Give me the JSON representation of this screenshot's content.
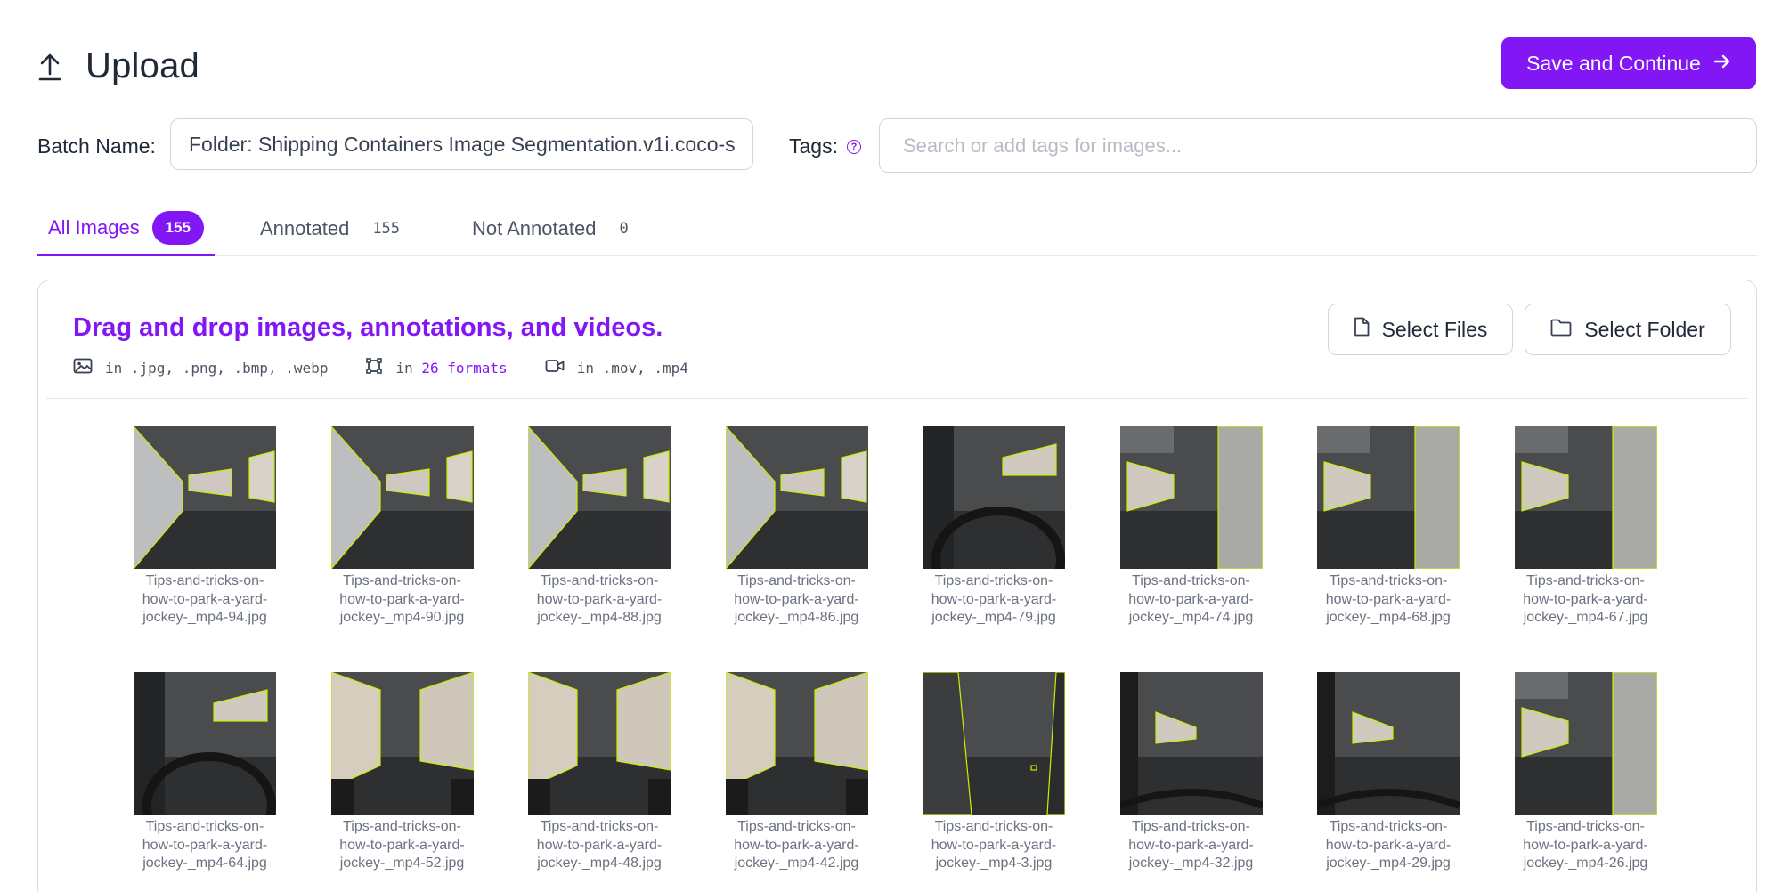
{
  "header": {
    "title": "Upload",
    "save_label": "Save and Continue"
  },
  "batch": {
    "label": "Batch Name:",
    "value": "Folder: Shipping Containers Image Segmentation.v1i.coco-s"
  },
  "tags": {
    "label": "Tags:",
    "help": "?",
    "placeholder": "Search or add tags for images..."
  },
  "tabs": [
    {
      "label": "All Images",
      "count": "155"
    },
    {
      "label": "Annotated",
      "count": "155"
    },
    {
      "label": "Not Annotated",
      "count": "0"
    }
  ],
  "dropzone": {
    "title": "Drag and drop images, annotations, and videos.",
    "images_formats": "in .jpg, .png, .bmp, .webp",
    "annotations_prefix": "in",
    "annotations_count": "26 formats",
    "video_formats": "in .mov, .mp4",
    "select_files": "Select Files",
    "select_folder": "Select Folder"
  },
  "images": [
    {
      "line1": "Tips-and-tricks-on-",
      "line2": "how-to-park-a-yard-",
      "line3": "jockey-_mp4-94.jpg",
      "scene": "left"
    },
    {
      "line1": "Tips-and-tricks-on-",
      "line2": "how-to-park-a-yard-",
      "line3": "jockey-_mp4-90.jpg",
      "scene": "left"
    },
    {
      "line1": "Tips-and-tricks-on-",
      "line2": "how-to-park-a-yard-",
      "line3": "jockey-_mp4-88.jpg",
      "scene": "left"
    },
    {
      "line1": "Tips-and-tricks-on-",
      "line2": "how-to-park-a-yard-",
      "line3": "jockey-_mp4-86.jpg",
      "scene": "left"
    },
    {
      "line1": "Tips-and-tricks-on-",
      "line2": "how-to-park-a-yard-",
      "line3": "jockey-_mp4-79.jpg",
      "scene": "cab"
    },
    {
      "line1": "Tips-and-tricks-on-",
      "line2": "how-to-park-a-yard-",
      "line3": "jockey-_mp4-74.jpg",
      "scene": "right"
    },
    {
      "line1": "Tips-and-tricks-on-",
      "line2": "how-to-park-a-yard-",
      "line3": "jockey-_mp4-68.jpg",
      "scene": "right"
    },
    {
      "line1": "Tips-and-tricks-on-",
      "line2": "how-to-park-a-yard-",
      "line3": "jockey-_mp4-67.jpg",
      "scene": "right"
    },
    {
      "line1": "Tips-and-tricks-on-",
      "line2": "how-to-park-a-yard-",
      "line3": "jockey-_mp4-64.jpg",
      "scene": "cab"
    },
    {
      "line1": "Tips-and-tricks-on-",
      "line2": "how-to-park-a-yard-",
      "line3": "jockey-_mp4-52.jpg",
      "scene": "both"
    },
    {
      "line1": "Tips-and-tricks-on-",
      "line2": "how-to-park-a-yard-",
      "line3": "jockey-_mp4-48.jpg",
      "scene": "both"
    },
    {
      "line1": "Tips-and-tricks-on-",
      "line2": "how-to-park-a-yard-",
      "line3": "jockey-_mp4-42.jpg",
      "scene": "both"
    },
    {
      "line1": "Tips-and-tricks-on-",
      "line2": "how-to-park-a-yard-",
      "line3": "jockey-_mp4-3.jpg",
      "scene": "mirror"
    },
    {
      "line1": "Tips-and-tricks-on-",
      "line2": "how-to-park-a-yard-",
      "line3": "jockey-_mp4-32.jpg",
      "scene": "road"
    },
    {
      "line1": "Tips-and-tricks-on-",
      "line2": "how-to-park-a-yard-",
      "line3": "jockey-_mp4-29.jpg",
      "scene": "road"
    },
    {
      "line1": "Tips-and-tricks-on-",
      "line2": "how-to-park-a-yard-",
      "line3": "jockey-_mp4-26.jpg",
      "scene": "right"
    }
  ],
  "colors": {
    "accent": "#8216f5",
    "annotation": "#c8f000",
    "photo_bg": "#4a4b4d"
  }
}
